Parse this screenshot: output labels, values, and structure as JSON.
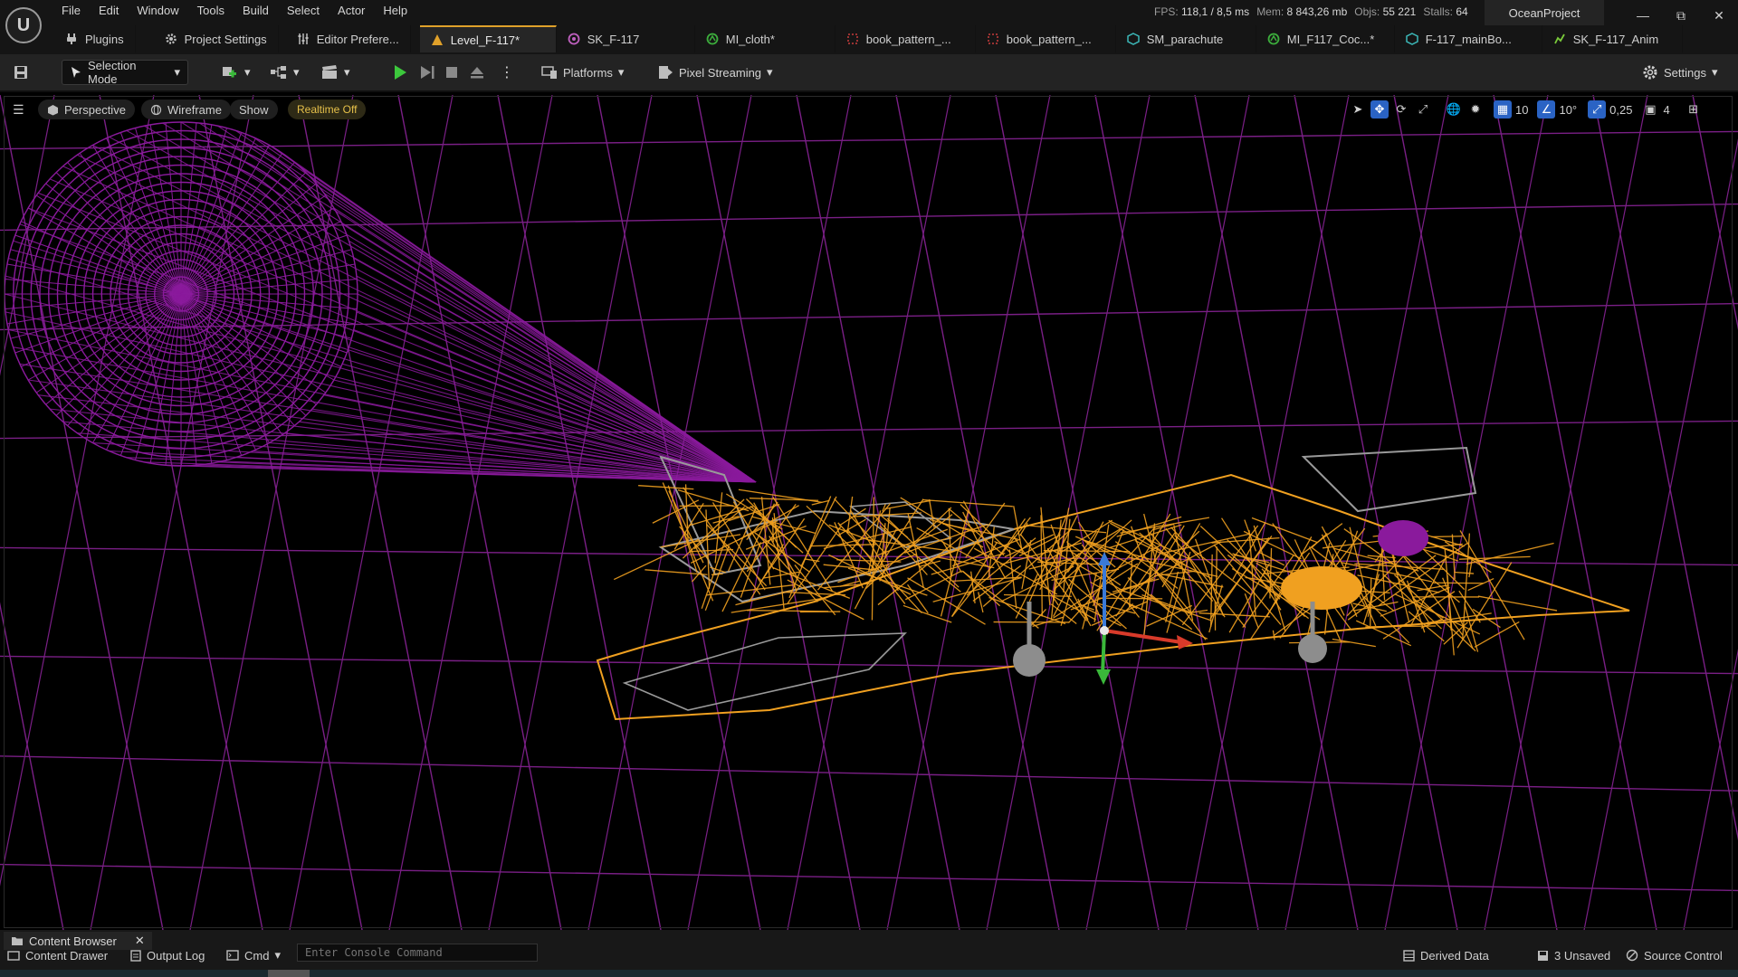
{
  "menu": [
    "File",
    "Edit",
    "Window",
    "Tools",
    "Build",
    "Select",
    "Actor",
    "Help"
  ],
  "stats": {
    "fps_label": "FPS:",
    "fps": "118,1",
    "ms": "/ 8,5 ms",
    "mem_label": "Mem:",
    "mem": "8 843,26 mb",
    "objs_label": "Objs:",
    "objs": "55 221",
    "stalls_label": "Stalls:",
    "stalls": "64"
  },
  "project_name": "OceanProject",
  "tabs": [
    {
      "label": "Plugins",
      "icon": "plug-icon",
      "color": "#bdbdbd"
    },
    {
      "label": "Project Settings",
      "icon": "gear-icon",
      "color": "#bdbdbd"
    },
    {
      "label": "Editor Prefere...",
      "icon": "sliders-icon",
      "color": "#bdbdbd"
    },
    {
      "label": "Level_F-117*",
      "icon": "level-icon",
      "color": "#e0a12a"
    },
    {
      "label": "SK_F-117",
      "icon": "skeletal-mesh-icon",
      "color": "#c060c0"
    },
    {
      "label": "MI_cloth*",
      "icon": "material-instance-icon",
      "color": "#3cae3c"
    },
    {
      "label": "book_pattern_...",
      "icon": "texture-icon",
      "color": "#c83c3c"
    },
    {
      "label": "book_pattern_...",
      "icon": "texture-icon",
      "color": "#c83c3c"
    },
    {
      "label": "SM_parachute",
      "icon": "static-mesh-icon",
      "color": "#3cb8b8"
    },
    {
      "label": "MI_F117_Coc...*",
      "icon": "material-instance-icon",
      "color": "#3cae3c"
    },
    {
      "label": "F-117_mainBo...",
      "icon": "static-mesh-icon",
      "color": "#3cb8b8"
    },
    {
      "label": "SK_F-117_Anim",
      "icon": "animation-icon",
      "color": "#7acb3a"
    }
  ],
  "toolbar": {
    "selection_mode": "Selection Mode",
    "platforms": "Platforms",
    "pixel_streaming": "Pixel Streaming",
    "settings": "Settings"
  },
  "viewport": {
    "perspective": "Perspective",
    "wireframe": "Wireframe",
    "show": "Show",
    "realtime": "Realtime Off",
    "grid_snap": "10",
    "rot_snap": "10°",
    "scale_snap": "0,25",
    "camera_speed": "4"
  },
  "bottom": {
    "content_browser": "Content Browser",
    "content_drawer": "Content Drawer",
    "output_log": "Output Log",
    "cmd": "Cmd",
    "console_placeholder": "Enter Console Command",
    "derived_data": "Derived Data",
    "unsaved": "3 Unsaved",
    "source_control": "Source Control"
  },
  "colors": {
    "accent": "#e0a12a",
    "wire_grid": "#7a1f86",
    "parachute": "#8a1a9c",
    "aircraft": "#f0a020",
    "gizmo_x": "#d83a2a",
    "gizmo_y": "#3ab83a",
    "gizmo_z": "#3a7ad8"
  }
}
